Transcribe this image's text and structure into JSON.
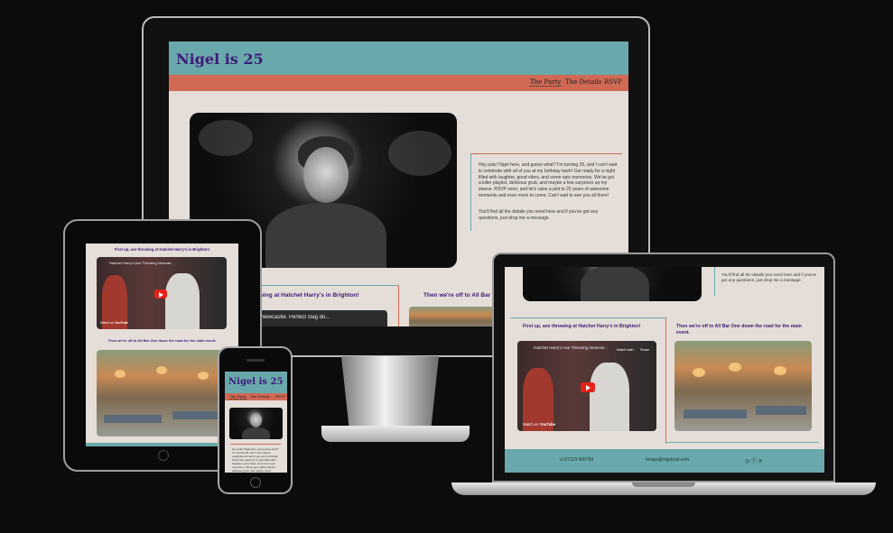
{
  "site": {
    "title": "Nigel is 25",
    "nav": [
      "The Party",
      "The Details",
      "RSVP"
    ],
    "intro_p1": "Hey pals! Nigel here, and guess what? I'm turning 25, and I can't wait to celebrate with all of you at my birthday bash! Get ready for a night filled with laughter, good vibes, and some epic memories. We've got a killer playlist, delicious grub, and maybe a few surprises up my sleeve. RSVP soon, and let's raise a pint to 25 years of awesome moments and even more to come. Can't wait to see you all there!",
    "intro_p2": "You'll find all the details you need here and if you've got any questions, just drop me a message.",
    "section1_title": "First up, axe throwing at Hatchet Harry's in Brighton!",
    "section2_title": "Then we're off to All Bar One down the road for the main event.",
    "video_title": "Hatchet Harry's Axe Throwing Newcastle. Perfect stag do...",
    "video_title_short": "Hatchet Harry's Axe Throwing Newcas...",
    "watch_on": "Watch on",
    "youtube": "YouTube",
    "watch_later": "Watch later",
    "share": "Share",
    "phone": "07123 456789",
    "email": "nige@nigelsnd.com",
    "imac_section1": "owing at Hatchet Harry's in Brighton!",
    "imac_section2": "Then we're off to All Bar O",
    "imac_video": "Newcastle. Perfect stag do..."
  },
  "colors": {
    "header": "#6aa9ab",
    "nav": "#d06a55",
    "title": "#3d1a7a",
    "background": "#e5ded8"
  }
}
